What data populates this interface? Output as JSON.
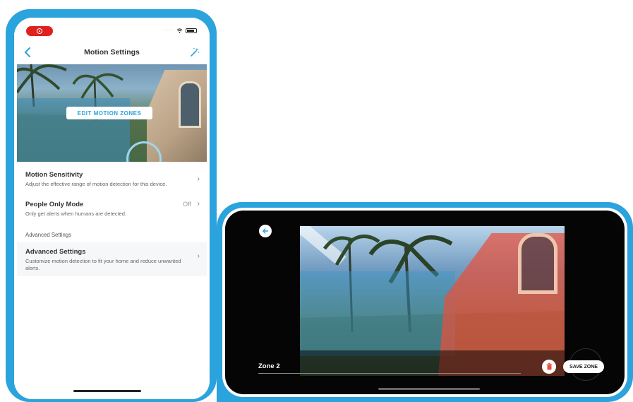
{
  "portrait": {
    "nav_title": "Motion Settings",
    "edit_zones_label": "EDIT MOTION ZONES",
    "rows": [
      {
        "title": "Motion Sensitivity",
        "desc": "Adjust the effective range of motion detection for this device.",
        "value": ""
      },
      {
        "title": "People Only Mode",
        "desc": "Only get alerts when humans are detected.",
        "value": "Off"
      }
    ],
    "section_label": "Advanced Settings",
    "advanced": {
      "title": "Advanced Settings",
      "desc": "Customize motion detection to fit your home and reduce unwanted alerts."
    },
    "icons": [
      "recording-icon",
      "wifi-icon",
      "battery-icon",
      "back-chevron-icon",
      "magic-wand-icon",
      "chevron-right-icon"
    ]
  },
  "landscape": {
    "zone_name": "Zone 2",
    "save_label": "SAVE ZONE",
    "icons": [
      "back-arrow-icon",
      "trash-icon"
    ]
  },
  "colors": {
    "frame_blue": "#2ba3dc",
    "record_red": "#e0211f",
    "zone_red": "#e8503c"
  }
}
